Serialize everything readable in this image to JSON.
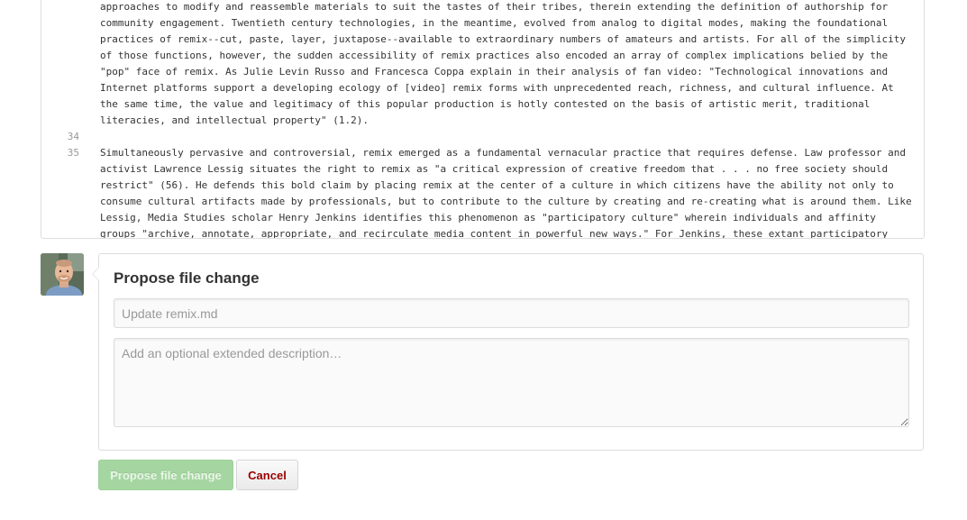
{
  "editor": {
    "lines": [
      {
        "number": "",
        "text": "approaches to modify and reassemble materials to suit the tastes of their tribes, therein extending the definition of authorship for community engagement. Twentieth century technologies, in the meantime, evolved from analog to digital modes, making the foundational practices of remix--cut, paste, layer, juxtapose--available to extraordinary numbers of amateurs and artists. For all of the simplicity of those functions, however, the sudden accessibility of remix practices also encoded an array of complex implications belied by the \"pop\" face of remix. As Julie Levin Russo and Francesca Coppa explain in their analysis of fan video: \"Technological innovations and Internet platforms support a developing ecology of [video] remix forms with unprecedented reach, richness, and cultural influence. At the same time, the value and legitimacy of this popular production is hotly contested on the basis of artistic merit, traditional literacies, and intellectual property\" (1.2)."
      },
      {
        "number": "34",
        "text": ""
      },
      {
        "number": "35",
        "text": "Simultaneously pervasive and controversial, remix emerged as a fundamental vernacular practice that requires defense. Law professor and activist Lawrence Lessig situates the right to remix as \"a critical expression of creative freedom that . . . no free society should restrict\" (56). He defends this bold claim by placing remix at the center of a culture in which citizens have the ability not only to consume cultural artifacts made by professionals, but to contribute to the culture by creating and re-creating what is around them. Like Lessig, Media Studies scholar Henry Jenkins identifies this phenomenon as \"participatory culture\" wherein individuals and affinity groups \"archive, annotate, appropriate, and recirculate media content in powerful new ways.\" For Jenkins, these extant participatory practices"
      }
    ]
  },
  "commit": {
    "title": "Propose file change",
    "summary_placeholder": "Update remix.md",
    "description_placeholder": "Add an optional extended description…",
    "submit_label": "Propose file change",
    "cancel_label": "Cancel"
  },
  "colors": {
    "primary_disabled": "#a5d6a1",
    "cancel_text": "#990000"
  }
}
